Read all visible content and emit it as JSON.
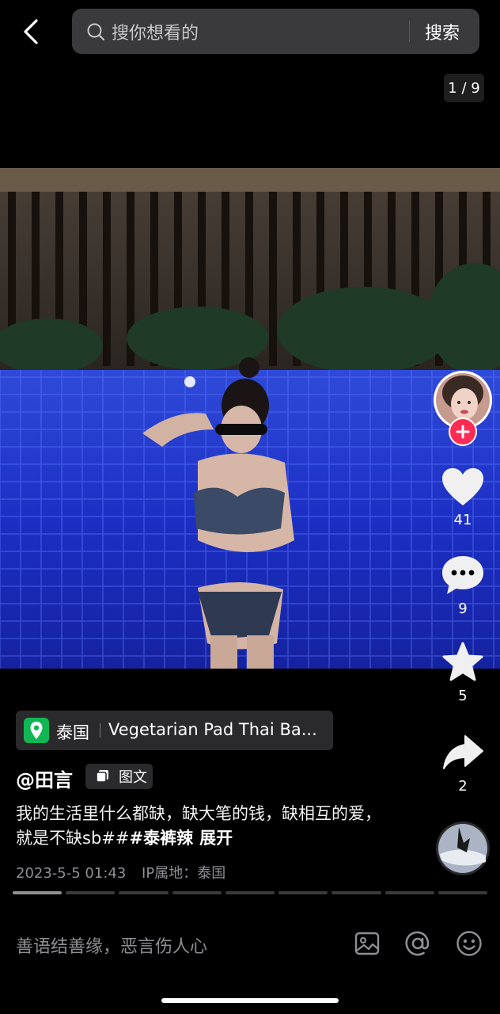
{
  "search": {
    "placeholder": "搜你想看的",
    "button": "搜索"
  },
  "pager": "1 / 9",
  "actions": {
    "likes": "41",
    "comments": "9",
    "favorites": "5",
    "shares": "2"
  },
  "location": {
    "country": "泰国",
    "place": "Vegetarian Pad Thai Ba..."
  },
  "author": "@田言",
  "post_type": "图文",
  "caption": {
    "text": "我的生活里什么都缺，缺大笔的钱，缺相互的爱，就是不缺sb##",
    "hashtag": "#泰裤辣",
    "expand": "展开"
  },
  "meta": {
    "date": "2023-5-5 01:43",
    "ip": "IP属地：泰国"
  },
  "comment_placeholder": "善语结善缘，恶言伤人心",
  "colors": {
    "like": "#f0f0f0",
    "follow_badge": "#fe2c55",
    "location_pin": "#12b755"
  }
}
